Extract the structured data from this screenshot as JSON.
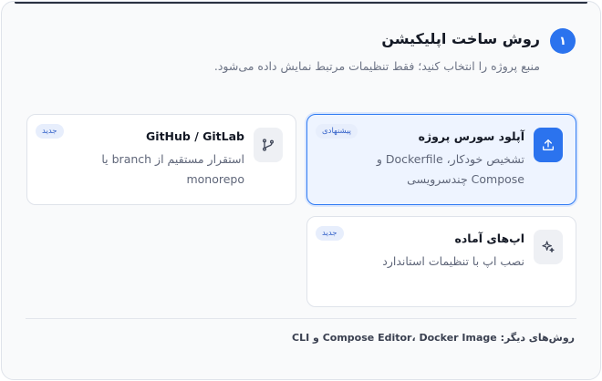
{
  "section": {
    "step_number": "۱",
    "title": "روش ساخت اپلیکیشن",
    "subtitle": "منبع پروژه را انتخاب کنید؛ فقط تنظیمات مرتبط نمایش داده می‌شود."
  },
  "options": [
    {
      "title": "آپلود سورس پروژه",
      "description": "تشخیص خودکار، Dockerfile و Compose چندسرویسی",
      "badge": "پیشنهادی",
      "icon": "upload-icon",
      "selected": true
    },
    {
      "title": "GitHub / GitLab",
      "description": "استقرار مستقیم از branch یا monorepo",
      "badge": "جدید",
      "icon": "git-branch-icon",
      "selected": false
    },
    {
      "title": "اپ‌های آماده",
      "description": "نصب اپ با تنظیمات استاندارد",
      "badge": "جدید",
      "icon": "sparkle-icon",
      "selected": false
    }
  ],
  "footer": {
    "text": "روش‌های دیگر: Compose Editor، Docker Image و CLI"
  },
  "colors": {
    "accent": "#2b73ee",
    "selected_border": "#2f7bf3",
    "badge_bg": "#e7eefc"
  }
}
